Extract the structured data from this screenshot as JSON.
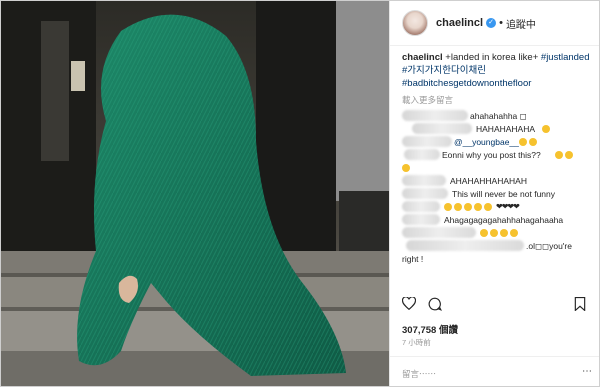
{
  "post": {
    "username": "chaelincl",
    "follow_label": "追蹤中",
    "caption_user": "chaelincl",
    "caption_text": " +landed in korea like+ ",
    "caption_tag1": "#justlanded",
    "caption_tag2": "#가지가지한다이채린",
    "caption_tag3": "#badbitchesgetdownonthefloor",
    "load_more": "載入更多留言",
    "comments": [
      {
        "text": "ahahahahha ◻"
      },
      {
        "text": "HAHAHAHAHA"
      },
      {
        "mention": "@__youngbae__"
      },
      {
        "text": "Eonni why you post this??"
      },
      {
        "text": ""
      },
      {
        "text": "AHAHAHHAHAHAH"
      },
      {
        "text": "This will never be not funny"
      },
      {
        "text": ""
      },
      {
        "text": "Ahagagagagahahhahagahaaha"
      },
      {
        "text": ""
      },
      {
        "text": ".ol◻◻you're"
      },
      {
        "text": "right !"
      }
    ],
    "likes": "307,758 個讚",
    "time": "7 小時前",
    "add_comment_placeholder": "留言⋯⋯",
    "options_icon": "more-options-icon",
    "colors": {
      "accent_blue": "#3897f0",
      "tag_blue": "#003569",
      "coat_green": "#1f8a66",
      "emoji_yellow": "#f6c22e"
    }
  }
}
